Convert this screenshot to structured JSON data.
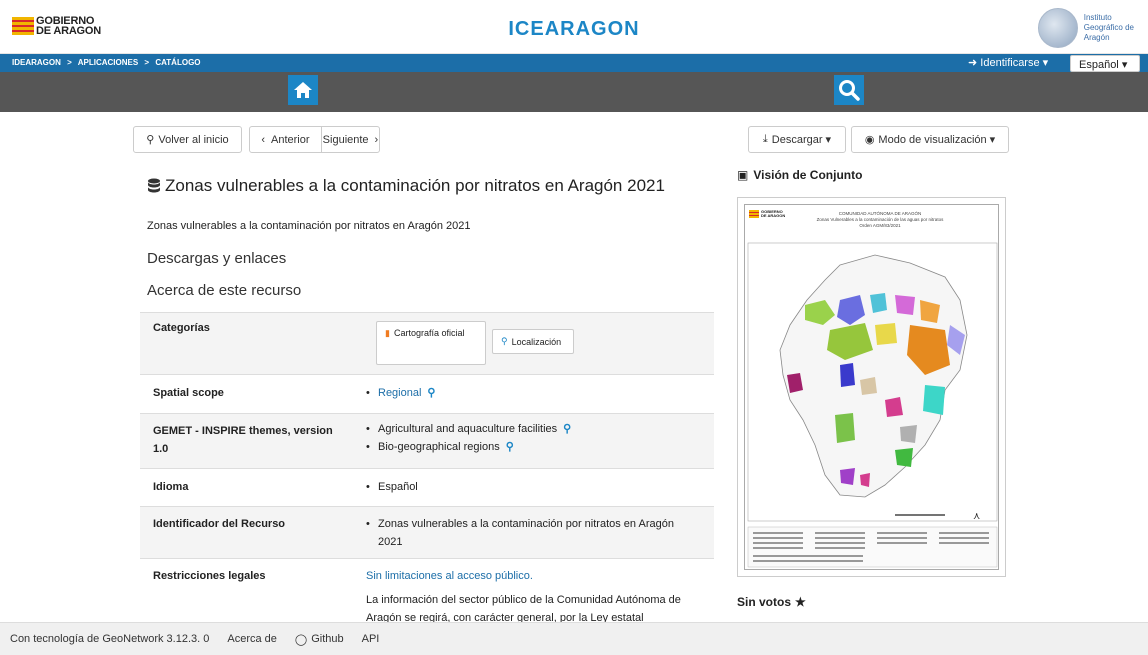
{
  "header": {
    "gov_logo_line1": "GOBIERNO",
    "gov_logo_line2": "DE ARAGON",
    "site_title": "ICEARAGON",
    "iga_line1": "Instituto",
    "iga_line2": "Geográfico de",
    "iga_line3": "Aragón"
  },
  "breadcrumb": [
    "IDEARAGON",
    ">",
    "APLICACIONES",
    ">",
    "CATÁLOGO"
  ],
  "login_label": "Identificarse",
  "language": "Español",
  "toolbar": {
    "back_home": "Volver al inicio",
    "previous": "Anterior",
    "next": "Siguiente",
    "download": "Descargar",
    "view_mode": "Modo de visualización"
  },
  "record": {
    "title": "Zonas vulnerables a la contaminación por nitratos en Aragón 2021",
    "abstract": "Zonas vulnerables a la contaminación por nitratos en Aragón 2021",
    "downloads_heading": "Descargas y enlaces",
    "about_heading": "Acerca de este recurso"
  },
  "table": {
    "categories_label": "Categorías",
    "cat_official": "Cartografía oficial",
    "cat_location": "Localización",
    "spatial_label": "Spatial scope",
    "spatial_value": "Regional",
    "gemet_label_1": "GEMET - INSPIRE themes, version",
    "gemet_label_2": "1.0",
    "gemet_value_1": "Agricultural and aquaculture facilities",
    "gemet_value_2": "Bio-geographical regions",
    "language_label": "Idioma",
    "language_value": "Español",
    "identifier_label": "Identificador del Recurso",
    "identifier_value_1": "Zonas vulnerables a la contaminación por nitratos en Aragón",
    "identifier_value_2": "2021",
    "legal_label": "Restricciones legales",
    "legal_link": "Sin limitaciones al acceso público.",
    "legal_text_1": "La información del sector público de la Comunidad Autónoma de",
    "legal_text_2": "Aragón se regirá, con carácter general, por la Ley estatal"
  },
  "sidebar": {
    "overview_heading": "Visión de Conjunto",
    "map_title_1": "COMUNIDAD AUTÓNOMA DE ARAGÓN",
    "map_title_2": "Zonas Vulnerables a la contaminación de las aguas por nitratos",
    "map_title_3": "Orden AGM/83/2021",
    "votes": "Sin votos"
  },
  "footer": {
    "powered": "Con tecnología de GeoNetwork 3.12.3. 0",
    "about": "Acerca de",
    "github": "Github",
    "api": "API"
  }
}
